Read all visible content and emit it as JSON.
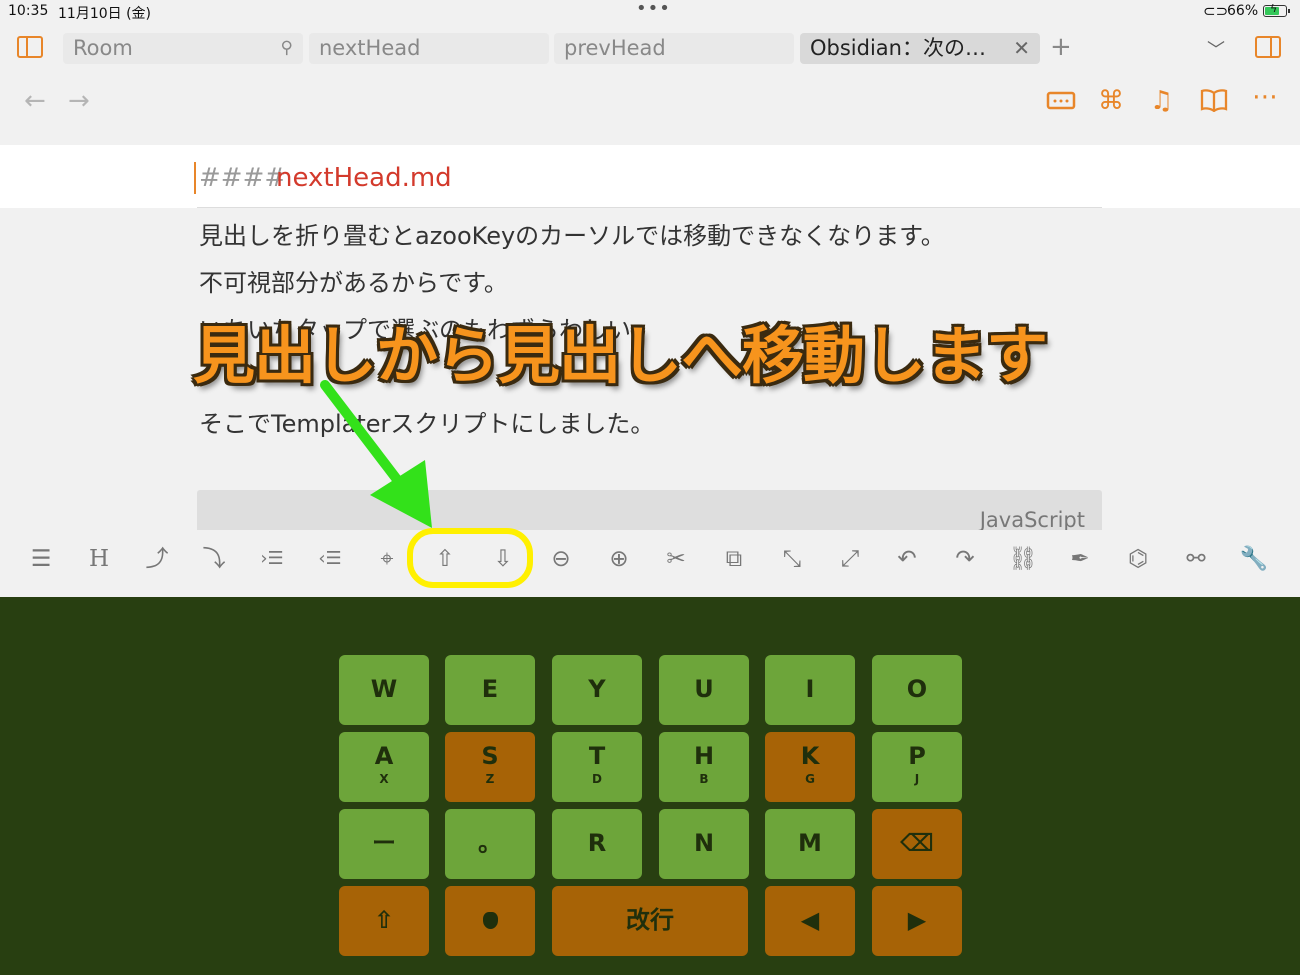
{
  "status": {
    "time": "10:35",
    "date": "11月10日 (金)",
    "battery": "66%"
  },
  "tabs": [
    {
      "label": "Room",
      "pinned": true
    },
    {
      "label": "nextHead"
    },
    {
      "label": "prevHead"
    },
    {
      "label": "Obsidian：次の…",
      "active": true
    }
  ],
  "editor": {
    "heading_marker": "####",
    "heading_text": "nextHead.md",
    "lines": [
      "見出しを折り畳むとazooKeyのカーソルでは移動できなくなります。",
      "不可視部分があるからです。",
      "いちいちタップで選ぶのもわずらわしい。",
      "そこでTemplaterスクリプトにしました。"
    ],
    "code_lang": "JavaScript"
  },
  "overlay": {
    "caption": "見出しから見出しへ移動します"
  },
  "colors": {
    "accent": "#e8862a",
    "key_green": "#6da53a",
    "key_orange": "#a76306",
    "keyboard_bg": "#283f11",
    "highlight": "#fff000",
    "arrow": "#33e11a"
  },
  "toolbar_icons": [
    "menu-icon",
    "heading-icon",
    "fold-up-icon",
    "fold-down-icon",
    "indent-icon",
    "outdent-icon",
    "crosshair-icon",
    "prev-heading-icon",
    "next-heading-icon",
    "zoom-out-icon",
    "zoom-in-icon",
    "scissors-icon",
    "copy-icon",
    "collapse-icon",
    "expand-icon",
    "undo-icon",
    "redo-icon",
    "link-icon",
    "pen-icon",
    "package-search-icon",
    "link-tool-icon",
    "wrench-icon"
  ],
  "keyboard": {
    "row1": [
      {
        "main": "W"
      },
      {
        "main": "E"
      },
      {
        "main": "Y"
      },
      {
        "main": "U"
      },
      {
        "main": "I"
      },
      {
        "main": "O"
      }
    ],
    "row2": [
      {
        "main": "A",
        "sub": "X"
      },
      {
        "main": "S",
        "sub": "Z"
      },
      {
        "main": "T",
        "sub": "D"
      },
      {
        "main": "H",
        "sub": "B"
      },
      {
        "main": "K",
        "sub": "G"
      },
      {
        "main": "P",
        "sub": "J"
      }
    ],
    "row3": [
      {
        "main": "ー"
      },
      {
        "main": "。"
      },
      {
        "main": "R"
      },
      {
        "main": "N"
      },
      {
        "main": "M"
      },
      {
        "main": "⌫"
      }
    ],
    "row4": [
      {
        "main": "⇧"
      },
      {
        "main": ""
      },
      {
        "main": "改行"
      },
      {
        "main": "◀"
      },
      {
        "main": "▶"
      }
    ]
  }
}
